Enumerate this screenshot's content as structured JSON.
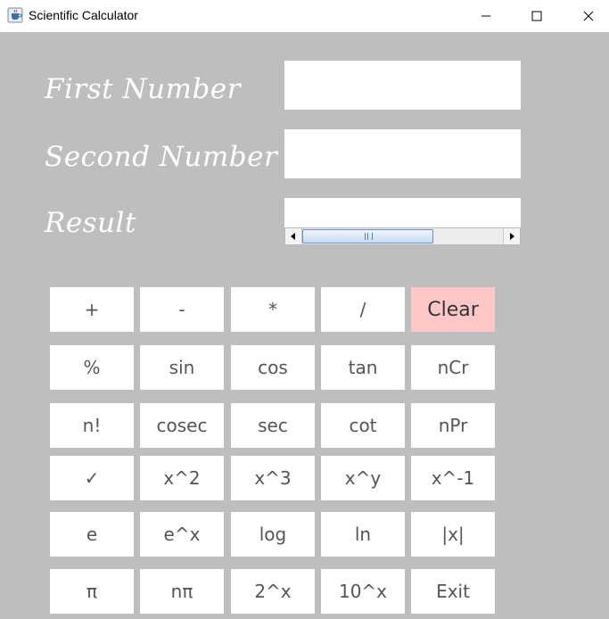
{
  "window": {
    "title": "Scientific Calculator",
    "icon": "java-cup-icon"
  },
  "labels": {
    "first": "First Number",
    "second": "Second Number",
    "result": "Result"
  },
  "fields": {
    "first_value": "",
    "second_value": "",
    "result_value": ""
  },
  "buttons": {
    "row1": [
      "+",
      "-",
      "*",
      "/",
      "Clear"
    ],
    "row2": [
      "%",
      "sin",
      "cos",
      "tan",
      "nCr"
    ],
    "row3": [
      "n!",
      "cosec",
      "sec",
      "cot",
      "nPr"
    ],
    "row4": [
      "✓",
      "x^2",
      "x^3",
      "x^y",
      "x^-1"
    ],
    "row5": [
      "e",
      "e^x",
      "log",
      "ln",
      "|x|"
    ],
    "row6": [
      "π",
      "nπ",
      "2^x",
      "10^x",
      "Exit"
    ]
  },
  "colors": {
    "background": "#bebebe",
    "clear_button": "#ffc8c8",
    "label_text": "#ffffff"
  }
}
